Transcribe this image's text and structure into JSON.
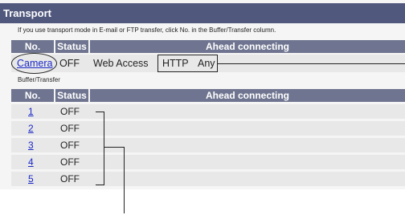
{
  "title": "Transport",
  "hint": "If you use transport mode in E-mail or FTP transfer, click No. in the Buffer/Transfer column.",
  "columns": {
    "no": "No.",
    "status": "Status",
    "ahead": "Ahead connecting"
  },
  "camera_row": {
    "no": "Camera",
    "status": "OFF",
    "ahead1": "Web Access",
    "ahead2": "HTTP",
    "ahead3": "Any"
  },
  "buffer_label": "Buffer/Transfer",
  "rows": [
    {
      "no": "1",
      "status": "OFF"
    },
    {
      "no": "2",
      "status": "OFF"
    },
    {
      "no": "3",
      "status": "OFF"
    },
    {
      "no": "4",
      "status": "OFF"
    },
    {
      "no": "5",
      "status": "OFF"
    }
  ],
  "colors": {
    "titlebar": "#51587e",
    "header": "#6f7590",
    "link": "#1a28c8"
  }
}
